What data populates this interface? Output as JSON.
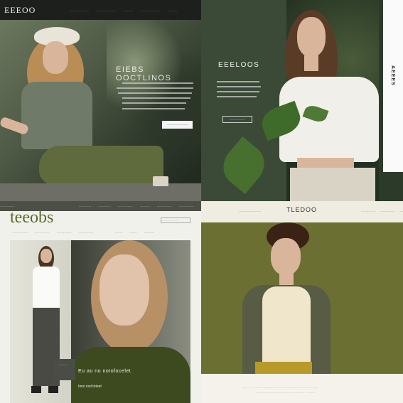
{
  "q1": {
    "logo": "EEEOO",
    "nav": [
      "————————",
      "————————",
      "————",
      "————————",
      "————"
    ],
    "headline": "EIEBS OOCTLINOS",
    "button": "——————————"
  },
  "q2": {
    "headline": "EEELOOS",
    "button": "———————",
    "side_text": "AEEES"
  },
  "q3": {
    "logo": "teeobs",
    "top_nav": [
      "——————",
      "—————",
      "—————",
      "——————",
      "————",
      "——————",
      "——————"
    ],
    "sub_nav": [
      "——————",
      "——————",
      "——————",
      "——————",
      "———",
      "———",
      "————"
    ],
    "search_placeholder": "————————",
    "card_text": "————",
    "caption": "Eu ao no notofocelet",
    "caption_sub": "Iono ionl toteet"
  },
  "q4": {
    "logo": "TLEDOO",
    "left_link": "—————————",
    "right_links": [
      "——————",
      "——————",
      "————"
    ],
    "footer_line_1": "——— ————— ———— ————— ——— ———— ————",
    "footer_line_2": "————— ———— ———— ————— ————"
  }
}
